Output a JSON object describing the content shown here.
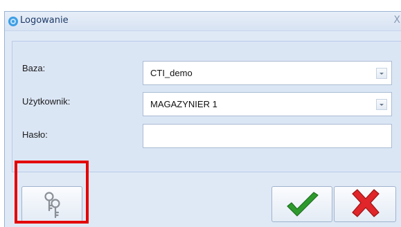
{
  "window": {
    "title": "Logowanie",
    "close_glyph": "X",
    "app_icon": "gear-blue-icon"
  },
  "form": {
    "database": {
      "label": "Baza:",
      "value": "CTI_demo"
    },
    "user": {
      "label": "Użytkownik:",
      "value": "MAGAZYNIER 1"
    },
    "password": {
      "label": "Hasło:",
      "value": ""
    }
  },
  "buttons": {
    "keys_icon": "keys-icon",
    "ok_icon": "checkmark-icon",
    "cancel_icon": "cross-icon"
  },
  "colors": {
    "accent_highlight": "#e40000",
    "ok_green": "#2e9a2e",
    "cancel_red": "#e0262a"
  }
}
